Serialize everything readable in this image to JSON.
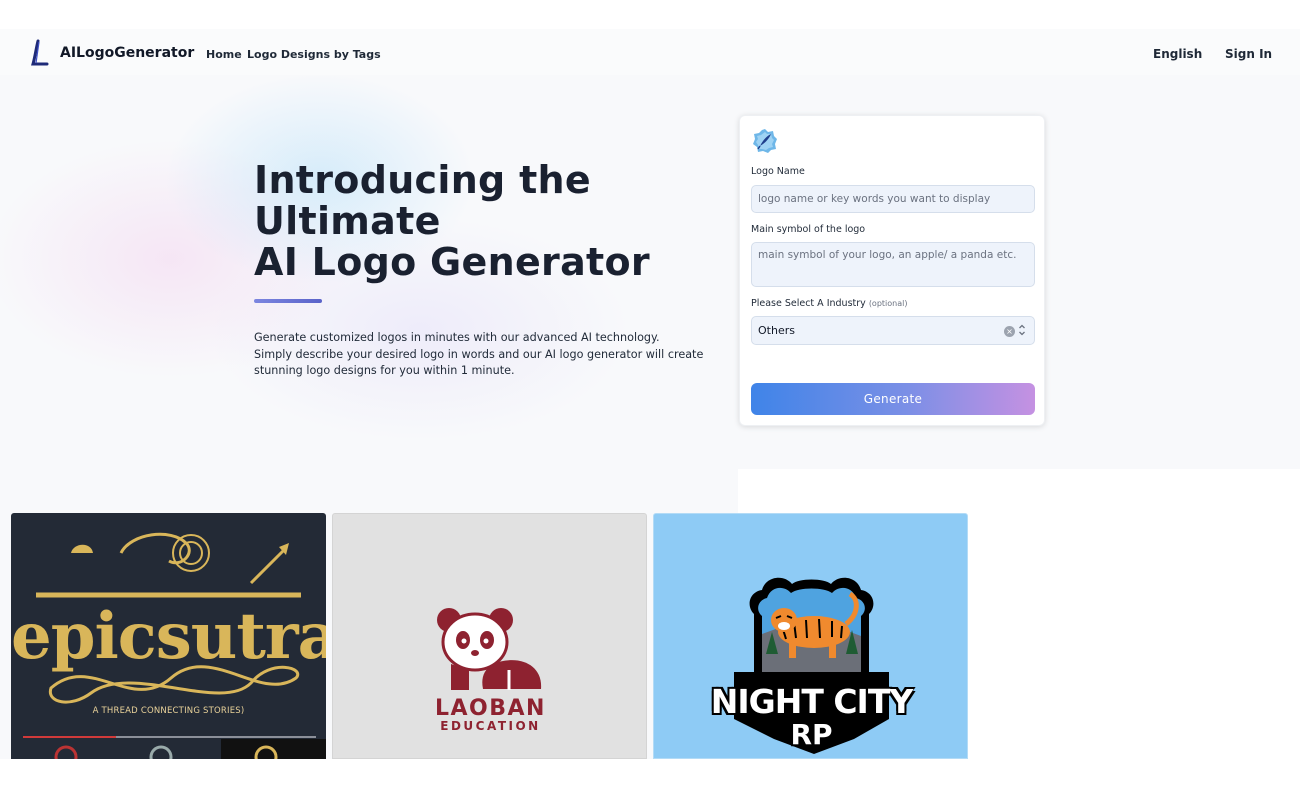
{
  "header": {
    "brand": "AILogoGenerator",
    "nav": [
      {
        "label": "Home"
      },
      {
        "label": "Logo Designs by Tags"
      }
    ],
    "language": "English",
    "sign_in": "Sign In"
  },
  "hero": {
    "title_lines": [
      "Introducing the",
      "Ultimate",
      "AI Logo Generator"
    ],
    "description_lines": [
      "Generate customized logos in minutes with our advanced AI technology.",
      "Simply describe your desired logo in words and our AI logo generator will create",
      "stunning logo designs for you within 1 minute."
    ]
  },
  "form": {
    "logo_name_label": "Logo Name",
    "logo_name_placeholder": "logo name or key words you want to display",
    "logo_name_value": "",
    "symbol_label": "Main symbol of the logo",
    "symbol_placeholder": "main symbol of your logo, an apple/ a panda etc.",
    "symbol_value": "",
    "industry_label": "Please Select A Industry",
    "industry_optional": "(optional)",
    "industry_value": "Others",
    "generate_label": "Generate"
  },
  "gallery": [
    {
      "text": "epicsutra",
      "subtitle": "A THREAD CONNECTING STORIES)"
    },
    {
      "text": "LAOBAN",
      "subtitle": "EDUCATION"
    },
    {
      "text": "NIGHT CITY",
      "subtitle": "RP"
    }
  ],
  "colors": {
    "accent_start": "#3f84e8",
    "accent_end": "#c591e2",
    "heading": "#1a2130",
    "panda_red": "#8e2230",
    "gold": "#d9b65a"
  }
}
